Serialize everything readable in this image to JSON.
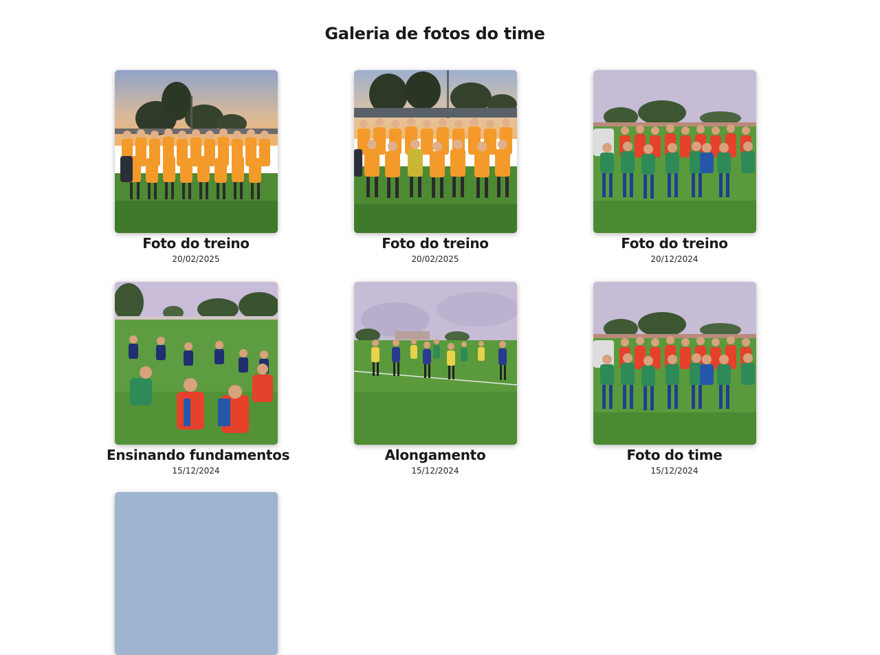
{
  "page": {
    "title": "Galeria de fotos do time"
  },
  "gallery": {
    "items": [
      {
        "caption": "Foto do treino",
        "date": "20/02/2025",
        "scene": "team-sunset-orange"
      },
      {
        "caption": "Foto do treino",
        "date": "20/02/2025",
        "scene": "team-sunset-orange"
      },
      {
        "caption": "Foto do treino",
        "date": "20/12/2024",
        "scene": "kids-red-green"
      },
      {
        "caption": "Ensinando fundamentos",
        "date": "15/12/2024",
        "scene": "kids-sitting-field"
      },
      {
        "caption": "Alongamento",
        "date": "15/12/2024",
        "scene": "kids-stretching-field"
      },
      {
        "caption": "Foto do time",
        "date": "15/12/2024",
        "scene": "kids-red-green"
      }
    ]
  },
  "colors": {
    "sky_sunset_top": "#8fa3c9",
    "sky_sunset_bottom": "#f0b46a",
    "sky_cloudy": "#c7bcd6",
    "grass": "#4d8a33",
    "jersey_orange": "#f39a2a",
    "jersey_red": "#e5412b",
    "jersey_green": "#2e8b57"
  }
}
